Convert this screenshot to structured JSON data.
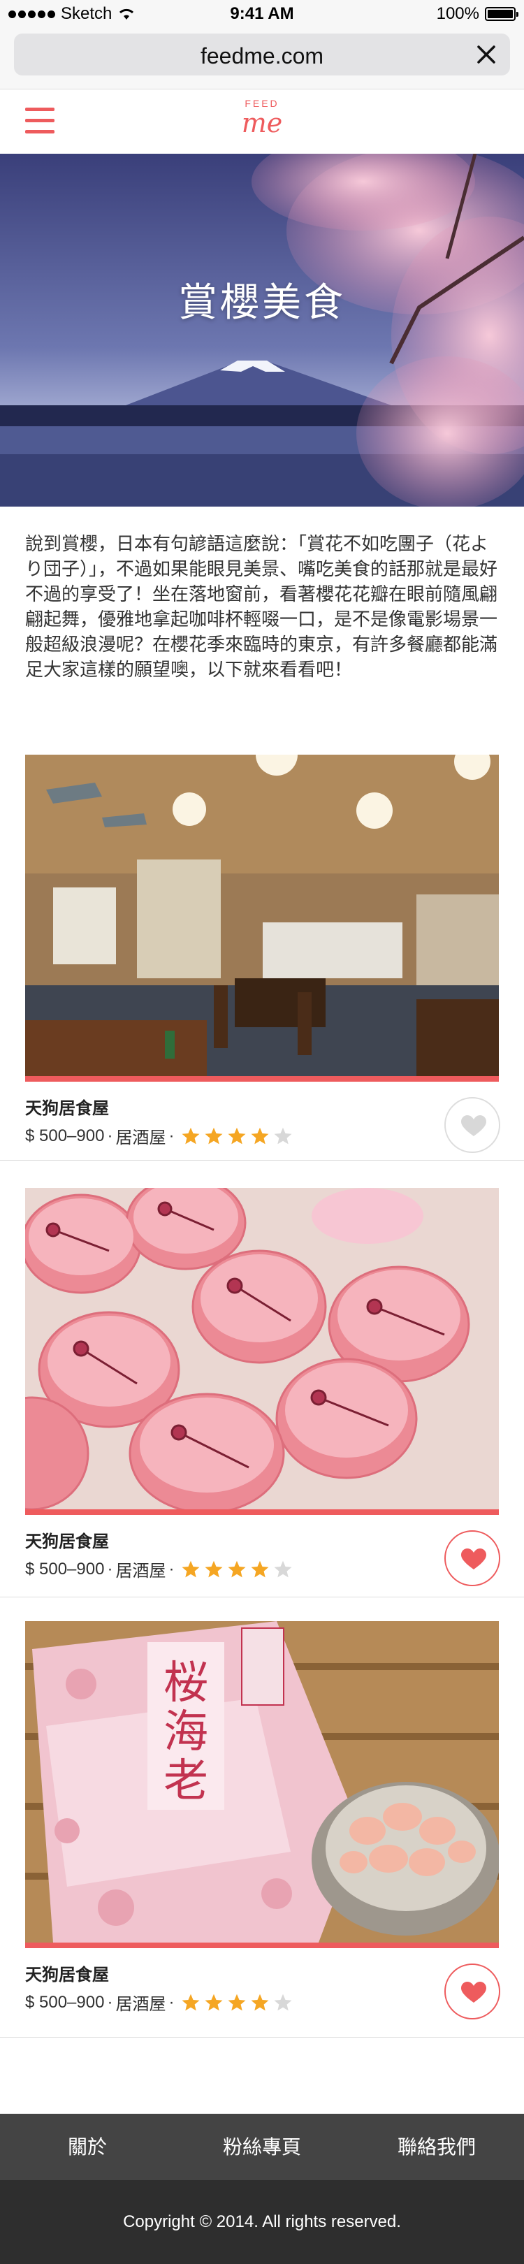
{
  "status_bar": {
    "carrier": "Sketch",
    "time": "9:41 AM",
    "battery": "100%"
  },
  "browser": {
    "url": "feedme.com",
    "close_icon": "close-icon"
  },
  "header": {
    "menu_icon": "hamburger-icon",
    "logo_top": "FEED",
    "logo_bottom": "me"
  },
  "hero": {
    "title": "賞櫻美食"
  },
  "intro": {
    "text": "說到賞櫻，日本有句諺語這麼說：「賞花不如吃團子（花より団子）」，不過如果能眼見美景、嘴吃美食的話那就是最好不過的享受了！坐在落地窗前，看著櫻花花瓣在眼前隨風翩翩起舞，優雅地拿起咖啡杯輕啜一口，是不是像電影場景一般超級浪漫呢？在櫻花季來臨時的東京，有許多餐廳都能滿足大家這樣的願望噢，以下就來看看吧！"
  },
  "cards": [
    {
      "name": "天狗居食屋",
      "price": "$ 500–900",
      "sep1": "·",
      "category": "居酒屋",
      "sep2": "·",
      "rating": 4,
      "rating_max": 5,
      "favorited": false
    },
    {
      "name": "天狗居食屋",
      "price": "$ 500–900",
      "sep1": "·",
      "category": "居酒屋",
      "sep2": "·",
      "rating": 4,
      "rating_max": 5,
      "favorited": true
    },
    {
      "name": "天狗居食屋",
      "price": "$ 500–900",
      "sep1": "·",
      "category": "居酒屋",
      "sep2": "·",
      "rating": 4,
      "rating_max": 5,
      "favorited": true
    }
  ],
  "footer": {
    "links": [
      "關於",
      "粉絲專頁",
      "聯絡我們"
    ],
    "copyright": "Copyright © 2014. All rights reserved."
  },
  "colors": {
    "accent": "#ee5b5d",
    "star": "#f5a623",
    "star_empty": "#d8d8d8",
    "footer_nav": "#444444",
    "footer_copy": "#2e2e2e"
  }
}
